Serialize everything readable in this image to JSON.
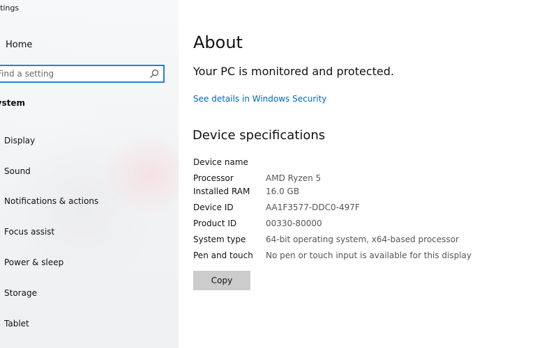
{
  "sidebar": {
    "app_title": "Settings",
    "home_label": "Home",
    "search_placeholder": "Find a setting",
    "section_title": "System",
    "items": [
      {
        "label": "Display",
        "icon": "display-icon"
      },
      {
        "label": "Sound",
        "icon": "sound-icon"
      },
      {
        "label": "Notifications & actions",
        "icon": "notifications-icon"
      },
      {
        "label": "Focus assist",
        "icon": "moon-icon"
      },
      {
        "label": "Power & sleep",
        "icon": "power-icon"
      },
      {
        "label": "Storage",
        "icon": "storage-icon"
      },
      {
        "label": "Tablet",
        "icon": "tablet-icon"
      }
    ]
  },
  "main": {
    "title": "About",
    "protection_status": "Your PC is monitored and protected.",
    "security_link": "See details in Windows Security",
    "specs_heading": "Device specifications",
    "specs": [
      {
        "label": "Device name",
        "value": ""
      },
      {
        "label": "Processor",
        "value": "AMD Ryzen 5"
      },
      {
        "label": "Installed RAM",
        "value": "16.0 GB"
      },
      {
        "label": "Device ID",
        "value": "AA1F3577-DDC0-497F"
      },
      {
        "label": "Product ID",
        "value": "00330-80000"
      },
      {
        "label": "System type",
        "value": "64-bit operating system, x64-based processor"
      },
      {
        "label": "Pen and touch",
        "value": "No pen or touch input is available for this display"
      }
    ],
    "copy_label": "Copy"
  },
  "colors": {
    "accent": "#2b7fc9",
    "link": "#0067c0",
    "button": "#cccccc"
  }
}
